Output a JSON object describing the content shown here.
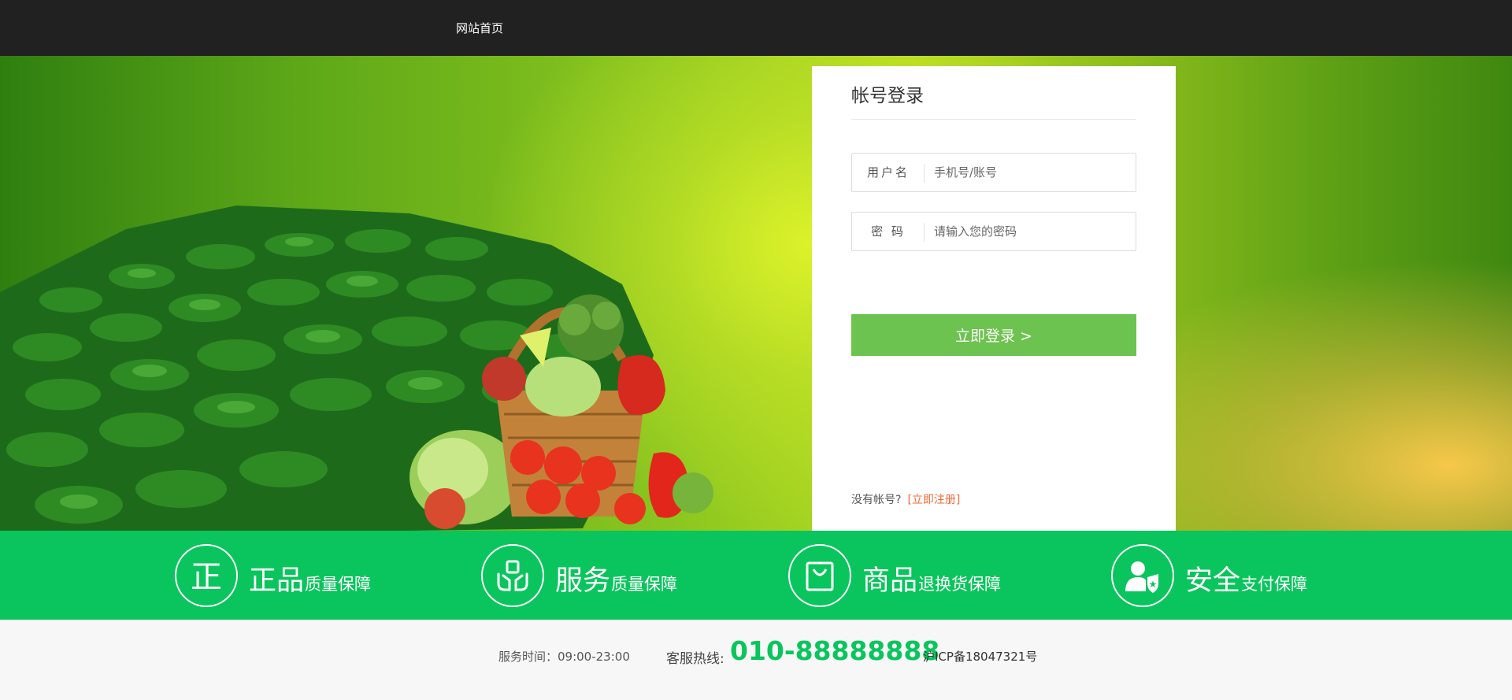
{
  "nav": {
    "home_link": "网站首页"
  },
  "login": {
    "title": "帐号登录",
    "username_label": "用户名",
    "username_placeholder": "手机号/账号",
    "password_label": "密 码",
    "password_placeholder": "请输入您的密码",
    "submit_label": "立即登录 >",
    "no_account_text": "没有帐号?",
    "register_link": "[立即注册]"
  },
  "features": [
    {
      "icon": "genuine-icon",
      "title": "正品",
      "subtitle": "质量保障"
    },
    {
      "icon": "service-hands-icon",
      "title": "服务",
      "subtitle": "质量保障"
    },
    {
      "icon": "shopping-bag-icon",
      "title": "商品",
      "subtitle": "退换货保障"
    },
    {
      "icon": "secure-user-icon",
      "title": "安全",
      "subtitle": "支付保障"
    }
  ],
  "footer": {
    "service_time": "服务时间：09:00-23:00",
    "hotline_label": "客服热线:",
    "hotline_number": "010-88888888",
    "icp": "沪ICP备18047321号"
  },
  "colors": {
    "topbar": "#212121",
    "features_bar": "#0ac55d",
    "login_button": "#6cc34f",
    "register_link": "#f06a3a",
    "hotline": "#0ac55d"
  }
}
